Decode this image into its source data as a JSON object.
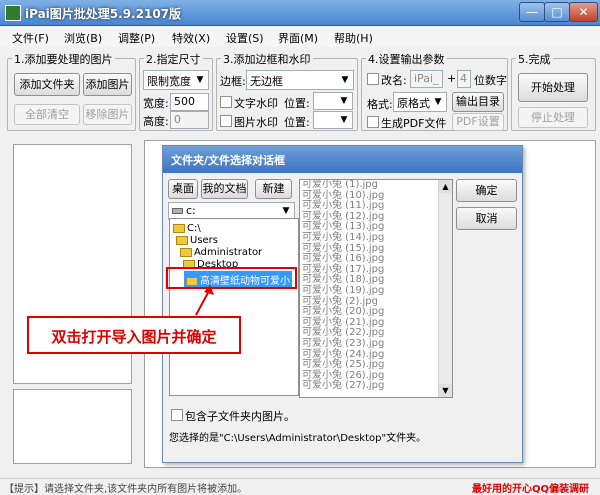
{
  "window": {
    "title": "iPai图片批处理5.9.2107版",
    "close": "✕",
    "maximize": "□",
    "minimize": "—"
  },
  "menu": [
    "文件(F)",
    "浏览(B)",
    "调整(P)",
    "特效(X)",
    "设置(S)",
    "界面(M)",
    "帮助(H)"
  ],
  "step1": {
    "label": "1.添加要处理的图片",
    "add_folder": "添加文件夹",
    "add_image": "添加图片",
    "clear_all": "全部清空",
    "remove_image": "移除图片"
  },
  "step2": {
    "label": "2.指定尺寸",
    "mode": "限制宽度",
    "width_label": "宽度:",
    "width_value": "500",
    "height_label": "高度:",
    "height_value": "0"
  },
  "step3": {
    "label": "3.添加边框和水印",
    "border_label": "边框:",
    "border_value": "无边框",
    "text_wm": "文字水印",
    "image_wm": "图片水印",
    "pos_label1": "位置:",
    "pos_label2": "位置:"
  },
  "step4": {
    "label": "4.设置输出参数",
    "rename": "改名:",
    "rename_value": "iPai_",
    "plus": "+",
    "digits_value": "4",
    "digits_label": "位数字",
    "format_label": "格式:",
    "format_value": "原格式",
    "output_dir": "输出目录",
    "gen_pdf": "生成PDF文件",
    "pdf_settings": "PDF设置"
  },
  "step5": {
    "label": "5.完成",
    "start": "开始处理",
    "stop": "停止处理"
  },
  "dialog": {
    "title": "文件夹/文件选择对话框",
    "desktop": "桌面",
    "my_docs": "我的文档",
    "new": "新建",
    "drive": "c:",
    "tree": [
      "C:\\",
      "Users",
      "Administrator",
      "Desktop",
      "高清壁纸动物可爱小"
    ],
    "files": [
      "可爱小兔 (1).jpg",
      "可爱小兔 (10).jpg",
      "可爱小兔 (11).jpg",
      "可爱小兔 (12).jpg",
      "可爱小兔 (13).jpg",
      "可爱小兔 (14).jpg",
      "可爱小兔 (15).jpg",
      "可爱小兔 (16).jpg",
      "可爱小兔 (17).jpg",
      "可爱小兔 (18).jpg",
      "可爱小兔 (19).jpg",
      "可爱小兔 (2).jpg",
      "可爱小兔 (20).jpg",
      "可爱小兔 (21).jpg",
      "可爱小兔 (22).jpg",
      "可爱小兔 (23).jpg",
      "可爱小兔 (24).jpg",
      "可爱小兔 (25).jpg",
      "可爱小兔 (26).jpg",
      "可爱小兔 (27).jpg"
    ],
    "ok": "确定",
    "cancel": "取消",
    "include_sub": "包含子文件夹内图片。",
    "selected_info": "您选择的是\"C:\\Users\\Administrator\\Desktop\"文件夹。"
  },
  "callout": "双击打开导入图片并确定",
  "status": {
    "tip": "【提示】请选择文件夹,该文件夹内所有图片将被添加。",
    "promo": "最好用的开心QQ偏装调研"
  },
  "colors": {
    "accent_red": "#e00000",
    "title_blue": "#4a86cf"
  }
}
